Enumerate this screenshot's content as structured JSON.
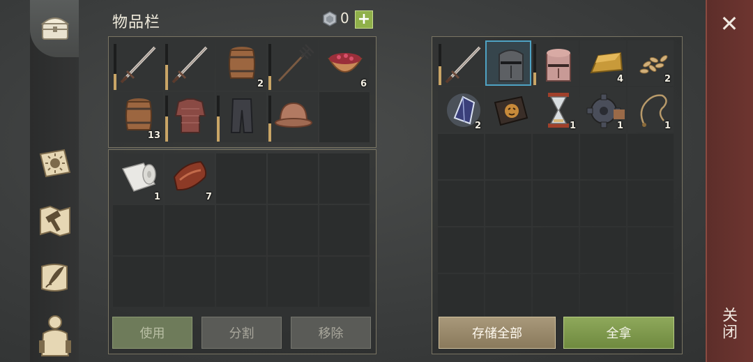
{
  "header": {
    "title": "物品栏",
    "currency_value": "0",
    "plus_label": "+"
  },
  "colors": {
    "accent_green": "#8fb04a",
    "selected_blue": "#4fa3c4",
    "durability": "#c9a566",
    "close_red": "#6e3530"
  },
  "sidebar": {
    "items": [
      {
        "name": "chest-tab",
        "icon": "chest-icon"
      },
      {
        "name": "tab-sun-book",
        "icon": "sun-book-icon"
      },
      {
        "name": "tab-crafting",
        "icon": "hammer-map-icon"
      },
      {
        "name": "tab-quests",
        "icon": "scroll-quill-icon"
      },
      {
        "name": "tab-character",
        "icon": "character-icon"
      }
    ]
  },
  "inventory": {
    "equipment_slots": [
      {
        "item": "sword",
        "qty": "",
        "durability": 0.35
      },
      {
        "item": "sword",
        "qty": "",
        "durability": 0.55
      },
      {
        "item": "barrel",
        "qty": "2",
        "durability": null
      },
      {
        "item": "pitchfork",
        "qty": "",
        "durability": 0.3
      },
      {
        "item": "berry-bowl",
        "qty": "6",
        "durability": null
      },
      {
        "item": "barrel",
        "qty": "13",
        "durability": null
      },
      {
        "item": "chainmail",
        "qty": "",
        "durability": 0.55
      },
      {
        "item": "pants",
        "qty": "",
        "durability": 0.55
      },
      {
        "item": "helmet",
        "qty": "",
        "durability": 0.4
      },
      {
        "item": "",
        "qty": "",
        "durability": null
      }
    ],
    "bag_slots": [
      {
        "item": "cloth-roll",
        "qty": "1"
      },
      {
        "item": "raw-meat",
        "qty": "7"
      },
      {
        "item": "",
        "qty": ""
      },
      {
        "item": "",
        "qty": ""
      },
      {
        "item": "",
        "qty": ""
      },
      {
        "item": "",
        "qty": ""
      },
      {
        "item": "",
        "qty": ""
      },
      {
        "item": "",
        "qty": ""
      },
      {
        "item": "",
        "qty": ""
      },
      {
        "item": "",
        "qty": ""
      },
      {
        "item": "",
        "qty": ""
      },
      {
        "item": "",
        "qty": ""
      },
      {
        "item": "",
        "qty": ""
      },
      {
        "item": "",
        "qty": ""
      },
      {
        "item": "",
        "qty": ""
      }
    ],
    "buttons": {
      "use": "使用",
      "split": "分割",
      "remove": "移除"
    }
  },
  "storage": {
    "slots": [
      {
        "item": "sword",
        "qty": "",
        "durability": 0.45,
        "selected": false
      },
      {
        "item": "knight-helmet",
        "qty": "",
        "durability": null,
        "selected": true
      },
      {
        "item": "knight-helmet-rusty",
        "qty": "",
        "durability": 0.3,
        "selected": false
      },
      {
        "item": "gold-bar",
        "qty": "4",
        "durability": null,
        "selected": false
      },
      {
        "item": "seeds",
        "qty": "2",
        "durability": null,
        "selected": false
      },
      {
        "item": "crystal",
        "qty": "2",
        "durability": null,
        "selected": false
      },
      {
        "item": "recipe-book",
        "qty": "",
        "durability": null,
        "selected": false
      },
      {
        "item": "hourglass",
        "qty": "1",
        "durability": null,
        "selected": false
      },
      {
        "item": "gear",
        "qty": "1",
        "durability": null,
        "selected": false
      },
      {
        "item": "rope",
        "qty": "1",
        "durability": null,
        "selected": false
      }
    ],
    "empty_rows": 4,
    "buttons": {
      "store_all": "存储全部",
      "take_all": "全拿"
    }
  },
  "close": {
    "label": "关闭",
    "icon": "close-icon"
  }
}
